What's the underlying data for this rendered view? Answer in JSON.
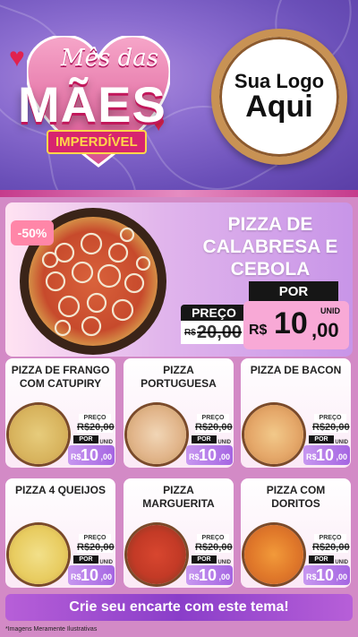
{
  "header": {
    "title_line1": "Mês das",
    "title_line2": "MÃES",
    "title_line3": "IMPERDÍVEL",
    "logo_line1": "Sua Logo",
    "logo_line2": "Aqui"
  },
  "hero": {
    "discount": "-50%",
    "name": "PIZZA DE CALABRESA E CEBOLA",
    "preco_label": "PREÇO",
    "por_label": "POR",
    "old_currency": "R$",
    "old_value": "20,00",
    "new_currency": "R$",
    "new_integer": "10",
    "new_cents": ",00",
    "unit": "UNID"
  },
  "products": [
    {
      "name": "PIZZA DE FRANGO COM CATUPIRY",
      "preco_label": "PREÇO",
      "old_price": "R$20,00",
      "por_label": "POR",
      "currency": "R$",
      "integer": "10",
      "cents": ",00",
      "unit": "UNID"
    },
    {
      "name": "PIZZA PORTUGUESA",
      "preco_label": "PREÇO",
      "old_price": "R$20,00",
      "por_label": "POR",
      "currency": "R$",
      "integer": "10",
      "cents": ",00",
      "unit": "UNID"
    },
    {
      "name": "PIZZA DE BACON",
      "preco_label": "PREÇO",
      "old_price": "R$20,00",
      "por_label": "POR",
      "currency": "R$",
      "integer": "10",
      "cents": ",00",
      "unit": "UNID"
    },
    {
      "name": "PIZZA 4 QUEIJOS",
      "preco_label": "PREÇO",
      "old_price": "R$20,00",
      "por_label": "POR",
      "currency": "R$",
      "integer": "10",
      "cents": ",00",
      "unit": "UNID"
    },
    {
      "name": "PIZZA MARGUERITA",
      "preco_label": "PREÇO",
      "old_price": "R$20,00",
      "por_label": "POR",
      "currency": "R$",
      "integer": "10",
      "cents": ",00",
      "unit": "UNID"
    },
    {
      "name": "PIZZA COM DORITOS",
      "preco_label": "PREÇO",
      "old_price": "R$20,00",
      "por_label": "POR",
      "currency": "R$",
      "integer": "10",
      "cents": ",00",
      "unit": "UNID"
    }
  ],
  "cta": {
    "label": "Crie seu encarte com este tema!"
  },
  "footer": {
    "disclaimer": "*Imagens Meramente Ilustrativas"
  },
  "colors": {
    "accent": "#a565e2",
    "pink": "#f8a9d6",
    "dark": "#161616"
  }
}
